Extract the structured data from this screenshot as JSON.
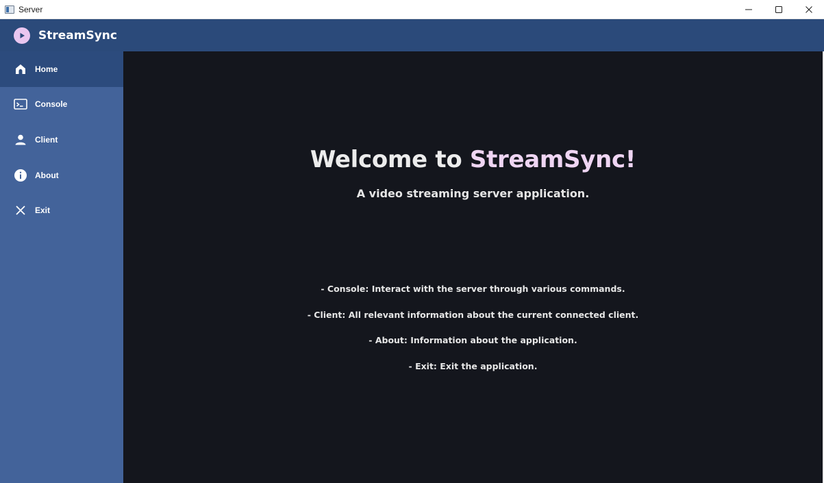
{
  "window": {
    "title": "Server"
  },
  "header": {
    "brand_name": "StreamSync",
    "brand_icon": "play-circle-icon"
  },
  "sidebar": {
    "items": [
      {
        "label": "Home",
        "icon": "home-icon",
        "active": true
      },
      {
        "label": "Console",
        "icon": "terminal-icon",
        "active": false
      },
      {
        "label": "Client",
        "icon": "person-icon",
        "active": false
      },
      {
        "label": "About",
        "icon": "info-icon",
        "active": false
      },
      {
        "label": "Exit",
        "icon": "close-icon",
        "active": false
      }
    ]
  },
  "main": {
    "welcome_prefix": "Welcome to ",
    "welcome_accent": "StreamSync!",
    "subtitle": "A video streaming server application.",
    "features": [
      "- Console: Interact with the server through various commands.",
      "- Client: All relevant information about the current connected client.",
      "- About: Information about the application.",
      "- Exit: Exit the application."
    ]
  },
  "colors": {
    "header_bg": "#2b4a7a",
    "sidebar_bg": "#43639a",
    "sidebar_active_bg": "#2c4b7d",
    "main_bg": "#14161d",
    "accent": "#efd5f3"
  }
}
